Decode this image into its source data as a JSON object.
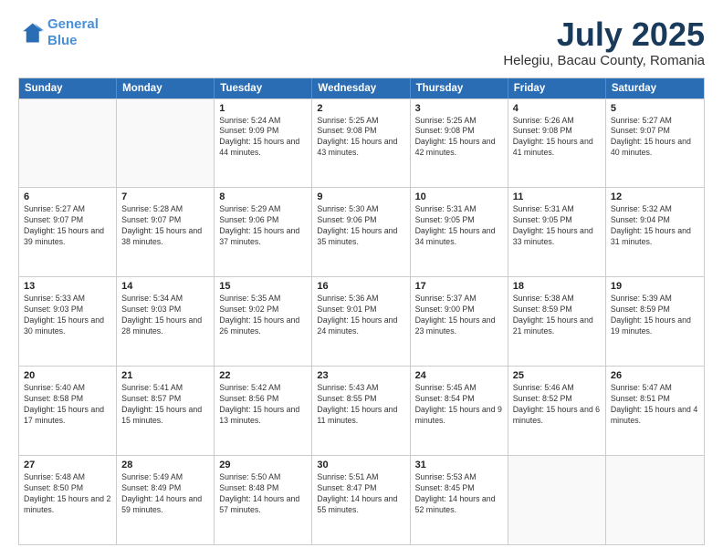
{
  "logo": {
    "line1": "General",
    "line2": "Blue"
  },
  "title": "July 2025",
  "location": "Helegiu, Bacau County, Romania",
  "header_days": [
    "Sunday",
    "Monday",
    "Tuesday",
    "Wednesday",
    "Thursday",
    "Friday",
    "Saturday"
  ],
  "weeks": [
    [
      {
        "day": "",
        "sunrise": "",
        "sunset": "",
        "daylight": ""
      },
      {
        "day": "",
        "sunrise": "",
        "sunset": "",
        "daylight": ""
      },
      {
        "day": "1",
        "sunrise": "Sunrise: 5:24 AM",
        "sunset": "Sunset: 9:09 PM",
        "daylight": "Daylight: 15 hours and 44 minutes."
      },
      {
        "day": "2",
        "sunrise": "Sunrise: 5:25 AM",
        "sunset": "Sunset: 9:08 PM",
        "daylight": "Daylight: 15 hours and 43 minutes."
      },
      {
        "day": "3",
        "sunrise": "Sunrise: 5:25 AM",
        "sunset": "Sunset: 9:08 PM",
        "daylight": "Daylight: 15 hours and 42 minutes."
      },
      {
        "day": "4",
        "sunrise": "Sunrise: 5:26 AM",
        "sunset": "Sunset: 9:08 PM",
        "daylight": "Daylight: 15 hours and 41 minutes."
      },
      {
        "day": "5",
        "sunrise": "Sunrise: 5:27 AM",
        "sunset": "Sunset: 9:07 PM",
        "daylight": "Daylight: 15 hours and 40 minutes."
      }
    ],
    [
      {
        "day": "6",
        "sunrise": "Sunrise: 5:27 AM",
        "sunset": "Sunset: 9:07 PM",
        "daylight": "Daylight: 15 hours and 39 minutes."
      },
      {
        "day": "7",
        "sunrise": "Sunrise: 5:28 AM",
        "sunset": "Sunset: 9:07 PM",
        "daylight": "Daylight: 15 hours and 38 minutes."
      },
      {
        "day": "8",
        "sunrise": "Sunrise: 5:29 AM",
        "sunset": "Sunset: 9:06 PM",
        "daylight": "Daylight: 15 hours and 37 minutes."
      },
      {
        "day": "9",
        "sunrise": "Sunrise: 5:30 AM",
        "sunset": "Sunset: 9:06 PM",
        "daylight": "Daylight: 15 hours and 35 minutes."
      },
      {
        "day": "10",
        "sunrise": "Sunrise: 5:31 AM",
        "sunset": "Sunset: 9:05 PM",
        "daylight": "Daylight: 15 hours and 34 minutes."
      },
      {
        "day": "11",
        "sunrise": "Sunrise: 5:31 AM",
        "sunset": "Sunset: 9:05 PM",
        "daylight": "Daylight: 15 hours and 33 minutes."
      },
      {
        "day": "12",
        "sunrise": "Sunrise: 5:32 AM",
        "sunset": "Sunset: 9:04 PM",
        "daylight": "Daylight: 15 hours and 31 minutes."
      }
    ],
    [
      {
        "day": "13",
        "sunrise": "Sunrise: 5:33 AM",
        "sunset": "Sunset: 9:03 PM",
        "daylight": "Daylight: 15 hours and 30 minutes."
      },
      {
        "day": "14",
        "sunrise": "Sunrise: 5:34 AM",
        "sunset": "Sunset: 9:03 PM",
        "daylight": "Daylight: 15 hours and 28 minutes."
      },
      {
        "day": "15",
        "sunrise": "Sunrise: 5:35 AM",
        "sunset": "Sunset: 9:02 PM",
        "daylight": "Daylight: 15 hours and 26 minutes."
      },
      {
        "day": "16",
        "sunrise": "Sunrise: 5:36 AM",
        "sunset": "Sunset: 9:01 PM",
        "daylight": "Daylight: 15 hours and 24 minutes."
      },
      {
        "day": "17",
        "sunrise": "Sunrise: 5:37 AM",
        "sunset": "Sunset: 9:00 PM",
        "daylight": "Daylight: 15 hours and 23 minutes."
      },
      {
        "day": "18",
        "sunrise": "Sunrise: 5:38 AM",
        "sunset": "Sunset: 8:59 PM",
        "daylight": "Daylight: 15 hours and 21 minutes."
      },
      {
        "day": "19",
        "sunrise": "Sunrise: 5:39 AM",
        "sunset": "Sunset: 8:59 PM",
        "daylight": "Daylight: 15 hours and 19 minutes."
      }
    ],
    [
      {
        "day": "20",
        "sunrise": "Sunrise: 5:40 AM",
        "sunset": "Sunset: 8:58 PM",
        "daylight": "Daylight: 15 hours and 17 minutes."
      },
      {
        "day": "21",
        "sunrise": "Sunrise: 5:41 AM",
        "sunset": "Sunset: 8:57 PM",
        "daylight": "Daylight: 15 hours and 15 minutes."
      },
      {
        "day": "22",
        "sunrise": "Sunrise: 5:42 AM",
        "sunset": "Sunset: 8:56 PM",
        "daylight": "Daylight: 15 hours and 13 minutes."
      },
      {
        "day": "23",
        "sunrise": "Sunrise: 5:43 AM",
        "sunset": "Sunset: 8:55 PM",
        "daylight": "Daylight: 15 hours and 11 minutes."
      },
      {
        "day": "24",
        "sunrise": "Sunrise: 5:45 AM",
        "sunset": "Sunset: 8:54 PM",
        "daylight": "Daylight: 15 hours and 9 minutes."
      },
      {
        "day": "25",
        "sunrise": "Sunrise: 5:46 AM",
        "sunset": "Sunset: 8:52 PM",
        "daylight": "Daylight: 15 hours and 6 minutes."
      },
      {
        "day": "26",
        "sunrise": "Sunrise: 5:47 AM",
        "sunset": "Sunset: 8:51 PM",
        "daylight": "Daylight: 15 hours and 4 minutes."
      }
    ],
    [
      {
        "day": "27",
        "sunrise": "Sunrise: 5:48 AM",
        "sunset": "Sunset: 8:50 PM",
        "daylight": "Daylight: 15 hours and 2 minutes."
      },
      {
        "day": "28",
        "sunrise": "Sunrise: 5:49 AM",
        "sunset": "Sunset: 8:49 PM",
        "daylight": "Daylight: 14 hours and 59 minutes."
      },
      {
        "day": "29",
        "sunrise": "Sunrise: 5:50 AM",
        "sunset": "Sunset: 8:48 PM",
        "daylight": "Daylight: 14 hours and 57 minutes."
      },
      {
        "day": "30",
        "sunrise": "Sunrise: 5:51 AM",
        "sunset": "Sunset: 8:47 PM",
        "daylight": "Daylight: 14 hours and 55 minutes."
      },
      {
        "day": "31",
        "sunrise": "Sunrise: 5:53 AM",
        "sunset": "Sunset: 8:45 PM",
        "daylight": "Daylight: 14 hours and 52 minutes."
      },
      {
        "day": "",
        "sunrise": "",
        "sunset": "",
        "daylight": ""
      },
      {
        "day": "",
        "sunrise": "",
        "sunset": "",
        "daylight": ""
      }
    ]
  ]
}
